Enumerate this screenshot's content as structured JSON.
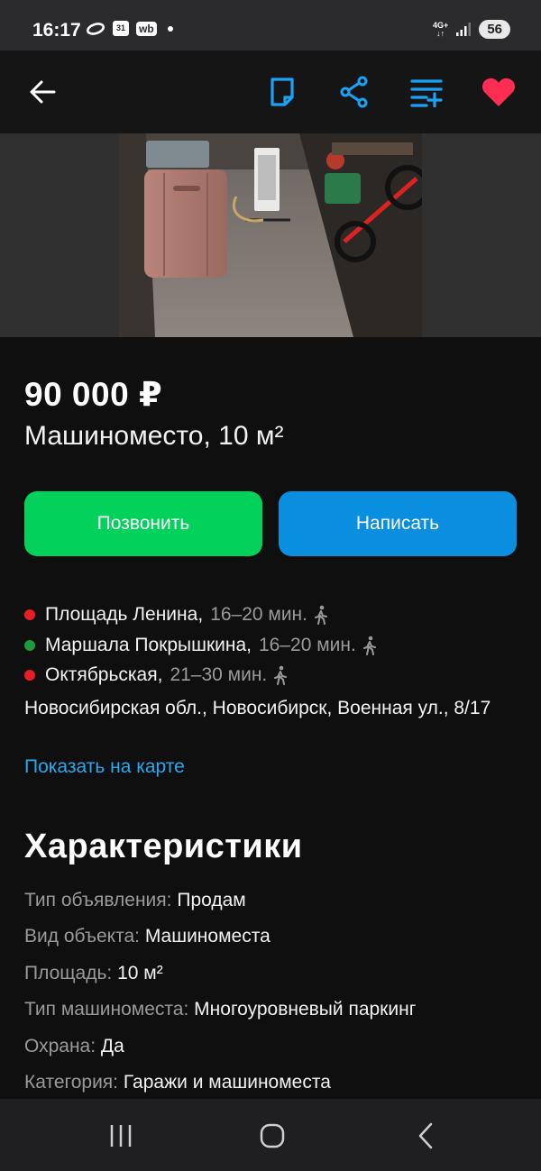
{
  "status_bar": {
    "time": "16:17",
    "calendar_day": "31",
    "wb": "wb",
    "network": "4G+",
    "battery": "56"
  },
  "toolbar": {
    "back": "back-arrow-icon",
    "note": "note-icon",
    "share": "share-icon",
    "compare": "compare-list-icon",
    "favorite": "heart-icon",
    "accent": "#1aa3f5",
    "favorite_color": "#ff2d52"
  },
  "listing": {
    "price": "90 000 ₽",
    "title": "Машиноместо, 10 м²",
    "call_label": "Позвонить",
    "write_label": "Написать",
    "metro": [
      {
        "color": "#e81d25",
        "name": "Площадь Ленина,",
        "time": "16–20 мин."
      },
      {
        "color": "#1d9a3a",
        "name": "Маршала Покрышкина,",
        "time": "16–20 мин."
      },
      {
        "color": "#e81d25",
        "name": "Октябрьская,",
        "time": "21–30 мин."
      }
    ],
    "address": "Новосибирская обл., Новосибирск, Военная ул., 8/17",
    "map_link": "Показать на карте"
  },
  "characteristics": {
    "title": "Характеристики",
    "items": [
      {
        "key": "Тип объявления:",
        "value": "Продам"
      },
      {
        "key": "Вид объекта:",
        "value": "Машиноместа"
      },
      {
        "key": "Площадь:",
        "value": "10 м²"
      },
      {
        "key": "Тип машиноместа:",
        "value": "Многоуровневый паркинг"
      },
      {
        "key": "Охрана:",
        "value": "Да"
      },
      {
        "key": "Категория:",
        "value": "Гаражи и машиноместа"
      }
    ]
  }
}
